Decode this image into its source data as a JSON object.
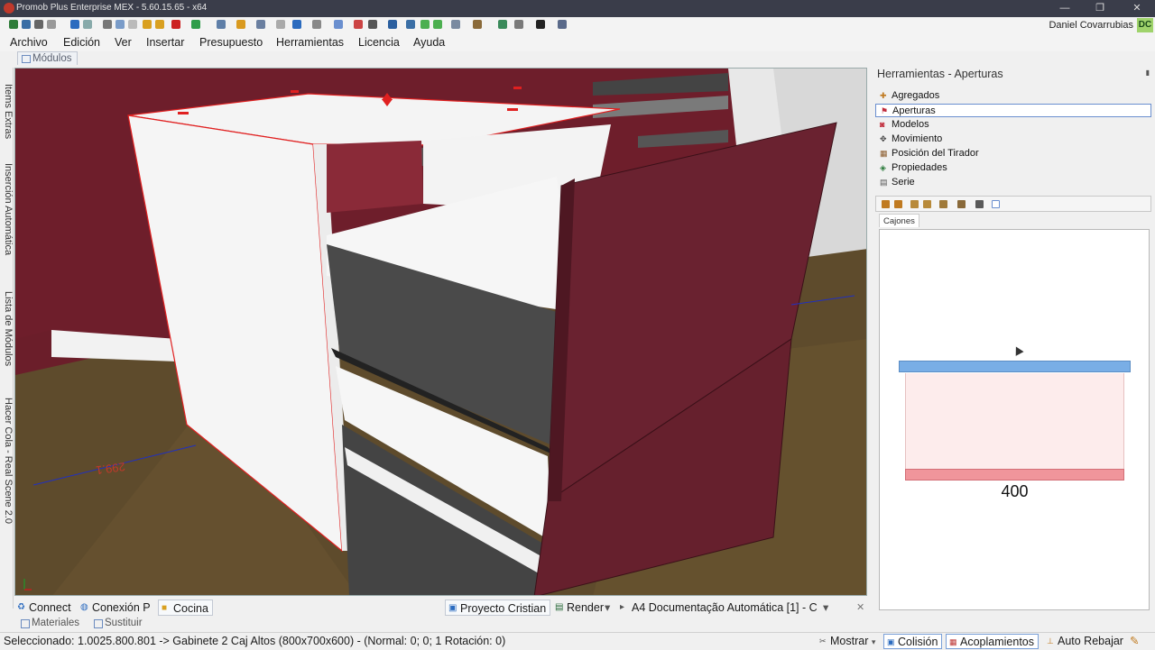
{
  "window": {
    "title": "Promob Plus Enterprise MEX - 5.60.15.65 - x64",
    "minimize_icon": "minimize-icon",
    "maximize_icon": "restore-icon",
    "close_icon": "close-icon"
  },
  "user": {
    "name": "Daniel Covarrubias",
    "initials": "DC"
  },
  "menu": [
    "Archivo",
    "Edición",
    "Ver",
    "Insertar",
    "Presupuesto",
    "Herramientas",
    "Licencia",
    "Ayuda"
  ],
  "modules_tab": "Módulos",
  "left_tabs": [
    "Items Extras",
    "Inserción Automática",
    "Lista de Módulos",
    "Hacer Cola - Real Scene 2.0"
  ],
  "viewport": {
    "dimension_label": "299.1",
    "colors": {
      "wall": "#6b1e2a",
      "floor": "#5c4a2a",
      "cabinet": "#f4f4f4",
      "front": "#6a2230",
      "selection": "#e02020",
      "axis": "#2030c0"
    }
  },
  "panel": {
    "title": "Herramientas - Aperturas",
    "items": [
      {
        "label": "Agregados",
        "icon": "add-icon"
      },
      {
        "label": "Aperturas",
        "icon": "opening-icon",
        "selected": true
      },
      {
        "label": "Modelos",
        "icon": "model-icon"
      },
      {
        "label": "Movimiento",
        "icon": "move-icon"
      },
      {
        "label": "Posición del Tirador",
        "icon": "handle-icon"
      },
      {
        "label": "Propiedades",
        "icon": "properties-icon"
      },
      {
        "label": "Serie",
        "icon": "series-icon"
      }
    ],
    "sub_tab": "Cajones",
    "drawer_value": "400"
  },
  "bottom_tabs": {
    "left": [
      {
        "label": "Connect",
        "icon": "connect-icon"
      },
      {
        "label": "Conexión P",
        "icon": "connection-icon"
      },
      {
        "label": "Cocina",
        "icon": "folder-icon"
      }
    ],
    "right": [
      {
        "label": "Proyecto Cristian",
        "icon": "project-icon"
      },
      {
        "label": "Render",
        "icon": "render-icon"
      },
      {
        "label": "A4 Documentação Automática [1] - C",
        "icon": "document-icon"
      }
    ],
    "close_icon": "close-icon"
  },
  "material_tabs": [
    "Materiales",
    "Sustituir"
  ],
  "status": {
    "text": "Seleccionado: 1.0025.800.801 -> Gabinete 2 Caj Altos (800x700x600) - (Normal: 0; 0; 1 Rotación: 0)",
    "mostrar": "Mostrar",
    "colision": "Colisión",
    "acoplamientos": "Acoplamientos",
    "auto_rebajar": "Auto Rebajar"
  }
}
